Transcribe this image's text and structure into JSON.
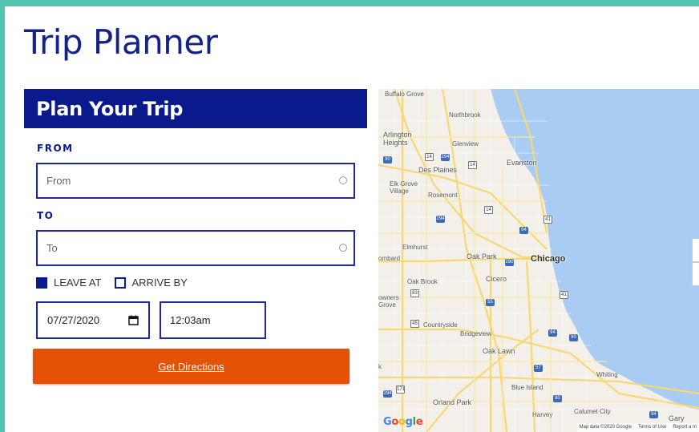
{
  "page": {
    "title": "Trip Planner"
  },
  "planner": {
    "header": "Plan Your Trip",
    "from": {
      "label": "FROM",
      "placeholder": "From"
    },
    "to": {
      "label": "TO",
      "placeholder": "To"
    },
    "mode": {
      "leave_at": "LEAVE AT",
      "arrive_by": "ARRIVE BY",
      "selected": "leave_at"
    },
    "date": "07/27/2020",
    "time": "12:03am",
    "submit_label": "Get Directions"
  },
  "map": {
    "labels": {
      "buffalo_grove": "Buffalo Grove",
      "northbrook": "Northbrook",
      "arlington_heights": "Arlington Heights",
      "glenview": "Glenview",
      "evanston": "Evanston",
      "des_plaines": "Des Plaines",
      "elk_grove": "Elk Grove Village",
      "rosemont": "Rosemont",
      "elmhurst": "Elmhurst",
      "lombard": "ombard",
      "oak_park": "Oak Park",
      "chicago": "Chicago",
      "cicero": "Cicero",
      "oak_brook": "Oak Brook",
      "owners_grove": "owners Grove",
      "countryside": "Countryside",
      "bridgeview": "Bridgeview",
      "oak_lawn": "Oak Lawn",
      "whiting": "Whiting",
      "blue_island": "Blue Island",
      "orland_park": "Orland Park",
      "harvey": "Harvey",
      "calumet_city": "Calumet City",
      "gary": "Gary",
      "edge_k": "k"
    },
    "shields": [
      "14",
      "294",
      "14",
      "90",
      "294",
      "41",
      "14",
      "94",
      "290",
      "41",
      "83",
      "45",
      "55",
      "94",
      "90",
      "57",
      "171",
      "294",
      "80",
      "94"
    ],
    "attribution": [
      "Map data ©2020 Google",
      "Terms of Use",
      "Report a m"
    ],
    "colors": {
      "water": "#a9cdf2",
      "land": "#f2f0e9",
      "major_road": "#f9d774"
    }
  }
}
